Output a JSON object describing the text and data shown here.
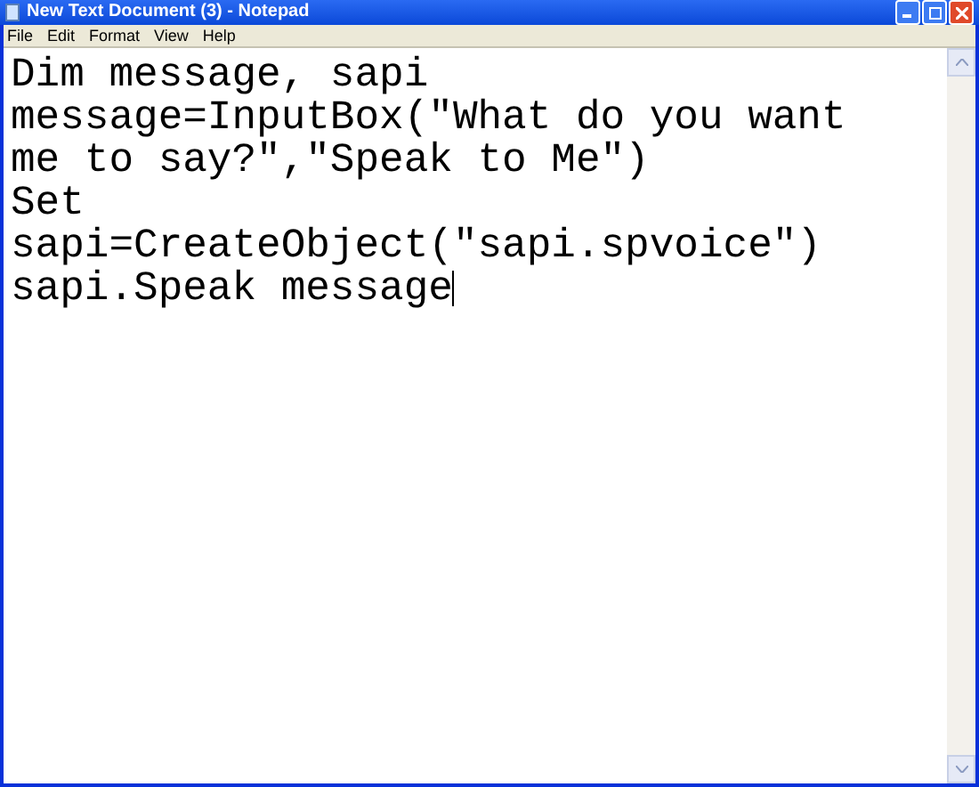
{
  "window": {
    "title": "New Text Document (3) - Notepad"
  },
  "menu": [
    "File",
    "Edit",
    "Format",
    "View",
    "Help"
  ],
  "editor": {
    "lines": [
      "Dim message, sapi",
      "message=InputBox(\"What do you want",
      "me to say?\",\"Speak to Me\")",
      "Set",
      "sapi=CreateObject(\"sapi.spvoice\")",
      "sapi.Speak message"
    ]
  }
}
